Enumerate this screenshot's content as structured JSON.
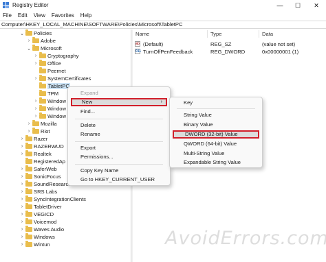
{
  "window": {
    "title": "Registry Editor",
    "minimize_glyph": "—",
    "maximize_glyph": "☐",
    "close_glyph": "✕"
  },
  "menubar": {
    "items": [
      "File",
      "Edit",
      "View",
      "Favorites",
      "Help"
    ]
  },
  "address": {
    "path": "Computer\\HKEY_LOCAL_MACHINE\\SOFTWARE\\Policies\\Microsoft\\TabletPC"
  },
  "tree": {
    "items": [
      {
        "label": "Policies",
        "chevron": "⌄"
      },
      {
        "label": "Adobe",
        "chevron": "›"
      },
      {
        "label": "Microsoft",
        "chevron": "⌄"
      },
      {
        "label": "Cryptography",
        "chevron": "›"
      },
      {
        "label": "Office",
        "chevron": "›"
      },
      {
        "label": "Peernet",
        "chevron": ""
      },
      {
        "label": "SystemCertificates",
        "chevron": "›"
      },
      {
        "label": "TabletPC",
        "chevron": ""
      },
      {
        "label": "TPM",
        "chevron": ""
      },
      {
        "label": "Window",
        "chevron": "›"
      },
      {
        "label": "Window",
        "chevron": "›"
      },
      {
        "label": "Window",
        "chevron": "›"
      },
      {
        "label": "Mozilla",
        "chevron": "›"
      },
      {
        "label": "Riot",
        "chevron": "›"
      },
      {
        "label": "Razer",
        "chevron": "›"
      },
      {
        "label": "RAZERWUD",
        "chevron": "›"
      },
      {
        "label": "Realtek",
        "chevron": "›"
      },
      {
        "label": "RegisteredAp",
        "chevron": ""
      },
      {
        "label": "SaferWeb",
        "chevron": "›"
      },
      {
        "label": "SonicFocus",
        "chevron": "›"
      },
      {
        "label": "SoundResearch",
        "chevron": "›"
      },
      {
        "label": "SRS Labs",
        "chevron": "›"
      },
      {
        "label": "SyncIntegrationClients",
        "chevron": "›"
      },
      {
        "label": "TabletDriver",
        "chevron": "›"
      },
      {
        "label": "VEGICD",
        "chevron": "›"
      },
      {
        "label": "Voicemod",
        "chevron": "›"
      },
      {
        "label": "Waves Audio",
        "chevron": "›"
      },
      {
        "label": "Windows",
        "chevron": "›"
      },
      {
        "label": "Wintun",
        "chevron": "›"
      }
    ]
  },
  "values_pane": {
    "headers": {
      "name": "Name",
      "type": "Type",
      "data": "Data"
    },
    "rows": [
      {
        "icon": "ab",
        "name": "(Default)",
        "type": "REG_SZ",
        "data": "(value not set)"
      },
      {
        "icon": "011",
        "name": "TurnOffPenFeedback",
        "type": "REG_DWORD",
        "data": "0x00000001 (1)"
      }
    ]
  },
  "context_menu": {
    "items": {
      "expand": "Expand",
      "new": "New",
      "find": "Find...",
      "delete": "Delete",
      "rename": "Rename",
      "export": "Export",
      "permissions": "Permissions...",
      "copy_key_name": "Copy Key Name",
      "goto": "Go to HKEY_CURRENT_USER"
    },
    "submenu_arrow": "›"
  },
  "new_submenu": {
    "items": {
      "key": "Key",
      "string": "String Value",
      "binary": "Binary Value",
      "dword": "DWORD (32-bit) Value",
      "qword": "QWORD (64-bit) Value",
      "multi_string": "Multi-String Value",
      "expandable": "Expandable String Value"
    }
  },
  "colors": {
    "highlight_border": "#d11f2a",
    "folder": "#e9bd4c",
    "selection": "#cce4f7"
  },
  "watermark": "AvoidErrors.com"
}
